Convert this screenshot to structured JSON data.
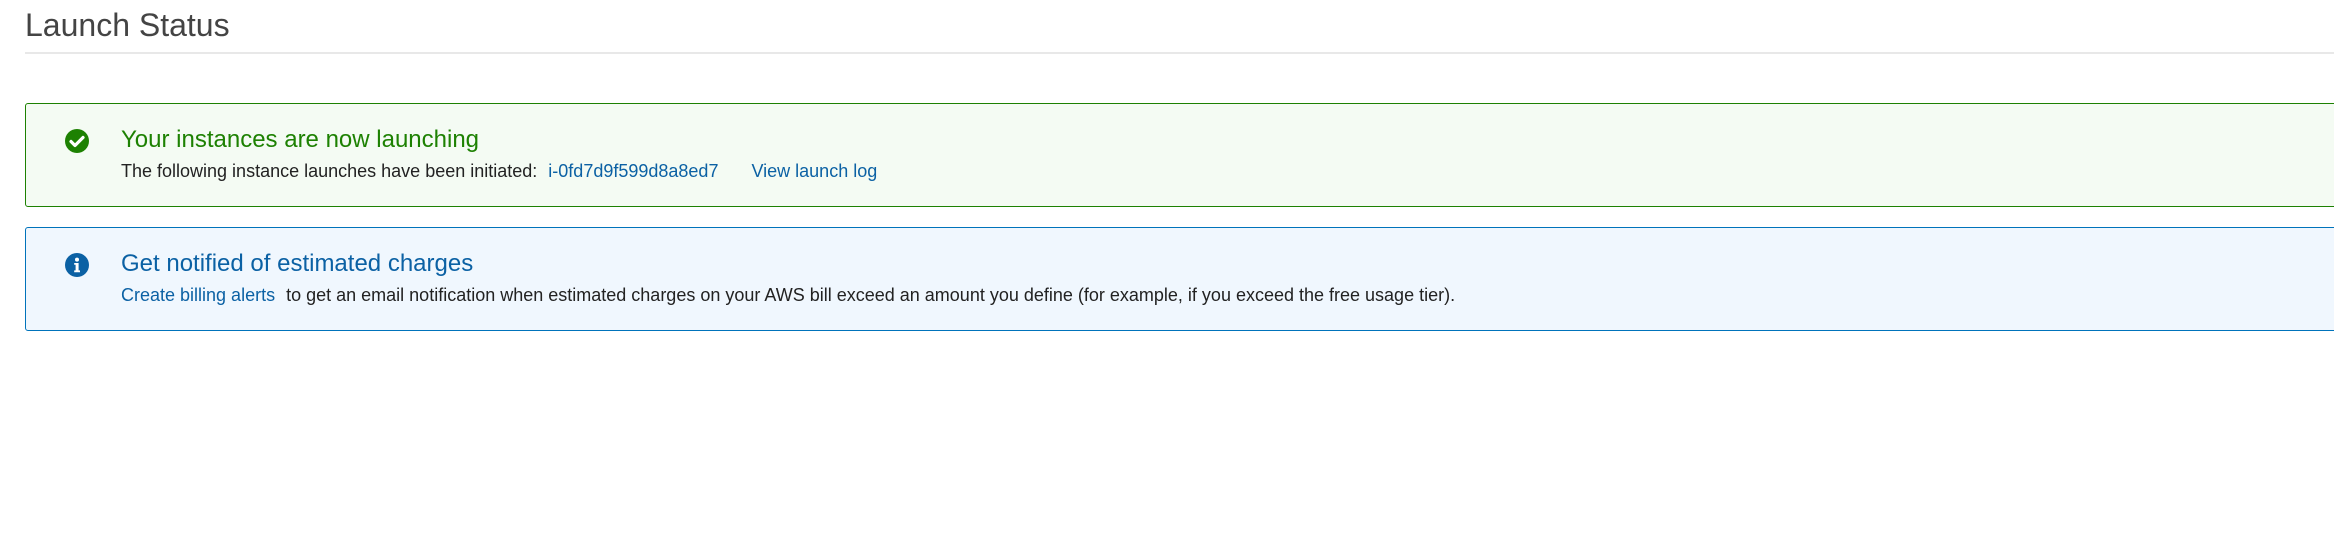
{
  "page": {
    "title": "Launch Status"
  },
  "success_alert": {
    "heading": "Your instances are now launching",
    "body_text": "The following instance launches have been initiated:",
    "instance_id": "i-0fd7d9f599d8a8ed7",
    "view_log_label": "View launch log",
    "icon": "check-circle-icon",
    "color": "#1d8102"
  },
  "info_alert": {
    "heading": "Get notified of estimated charges",
    "link_label": "Create billing alerts",
    "body_text": "to get an email notification when estimated charges on your AWS bill exceed an amount you define (for example, if you exceed the free usage tier).",
    "icon": "info-circle-icon",
    "color": "#0b61a4"
  }
}
